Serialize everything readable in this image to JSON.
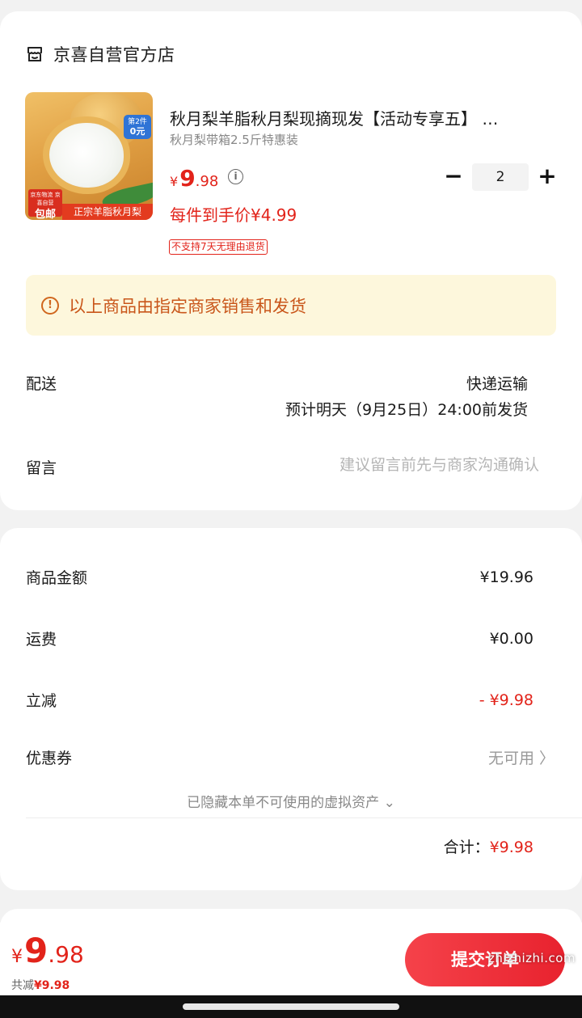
{
  "store": {
    "name": "京喜自营官方店"
  },
  "product": {
    "title": "秋月梨羊脂秋月梨现摘现发【活动专享五】 …",
    "spec": "秋月梨带箱2.5斤特惠装",
    "price_symbol": "¥",
    "price_int": "9",
    "price_dec": ".98",
    "unit_price": "每件到手价¥4.99",
    "return_policy": "不支持7天无理由退货",
    "quantity": "2",
    "thumb": {
      "badge_top": "第2件",
      "badge_bottom": "0元",
      "tag_small": "京东物流 京喜自营",
      "tag_big": "包邮",
      "banner": "正宗羊脂秋月梨"
    }
  },
  "notice": {
    "text": "以上商品由指定商家销售和发货"
  },
  "delivery": {
    "label": "配送",
    "method": "快递运输",
    "eta": "预计明天（9月25日）24:00前发货"
  },
  "message": {
    "label": "留言",
    "placeholder": "建议留言前先与商家沟通确认"
  },
  "summary": {
    "goods_label": "商品金额",
    "goods_value": "¥19.96",
    "shipping_label": "运费",
    "shipping_value": "¥0.00",
    "discount_label": "立减",
    "discount_value": "- ¥9.98",
    "coupon_label": "优惠券",
    "coupon_value": "无可用 〉",
    "hidden_assets": "已隐藏本单不可使用的虚拟资产 ⌄",
    "total_label": "合计：",
    "total_value": "¥9.98"
  },
  "bottom": {
    "price_symbol": "¥",
    "price_int": "9",
    "price_dec": ".98",
    "saved_label": "共减",
    "saved_value": "¥9.98",
    "pay_label": "提交订单"
  },
  "watermark": "zhizhizhi.com",
  "colors": {
    "accent_red": "#e2231a",
    "notice_bg": "#fdf7dc",
    "notice_text": "#c9561a"
  }
}
